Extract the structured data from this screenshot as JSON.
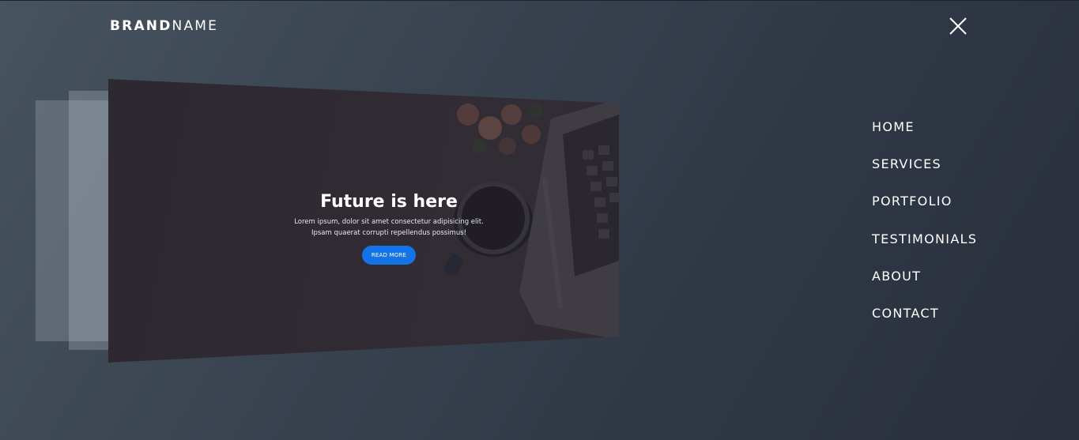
{
  "brand": {
    "bold": "BRAND",
    "light": "NAME"
  },
  "close_icon": "close-icon",
  "nav": {
    "items": [
      {
        "label": "HOME"
      },
      {
        "label": "SERVICES"
      },
      {
        "label": "PORTFOLIO"
      },
      {
        "label": "TESTIMONIALS"
      },
      {
        "label": "ABOUT"
      },
      {
        "label": "CONTACT"
      }
    ]
  },
  "slide": {
    "title": "Future is here",
    "text_line1": "Lorem ipsum, dolor sit amet consectetur adipisicing elit.",
    "text_line2": "Ipsam quaerat corrupti repellendus possimus!",
    "button_label": "READ MORE"
  },
  "colors": {
    "accent": "#1473e6",
    "background": "#3a4451",
    "text": "#ffffff"
  }
}
